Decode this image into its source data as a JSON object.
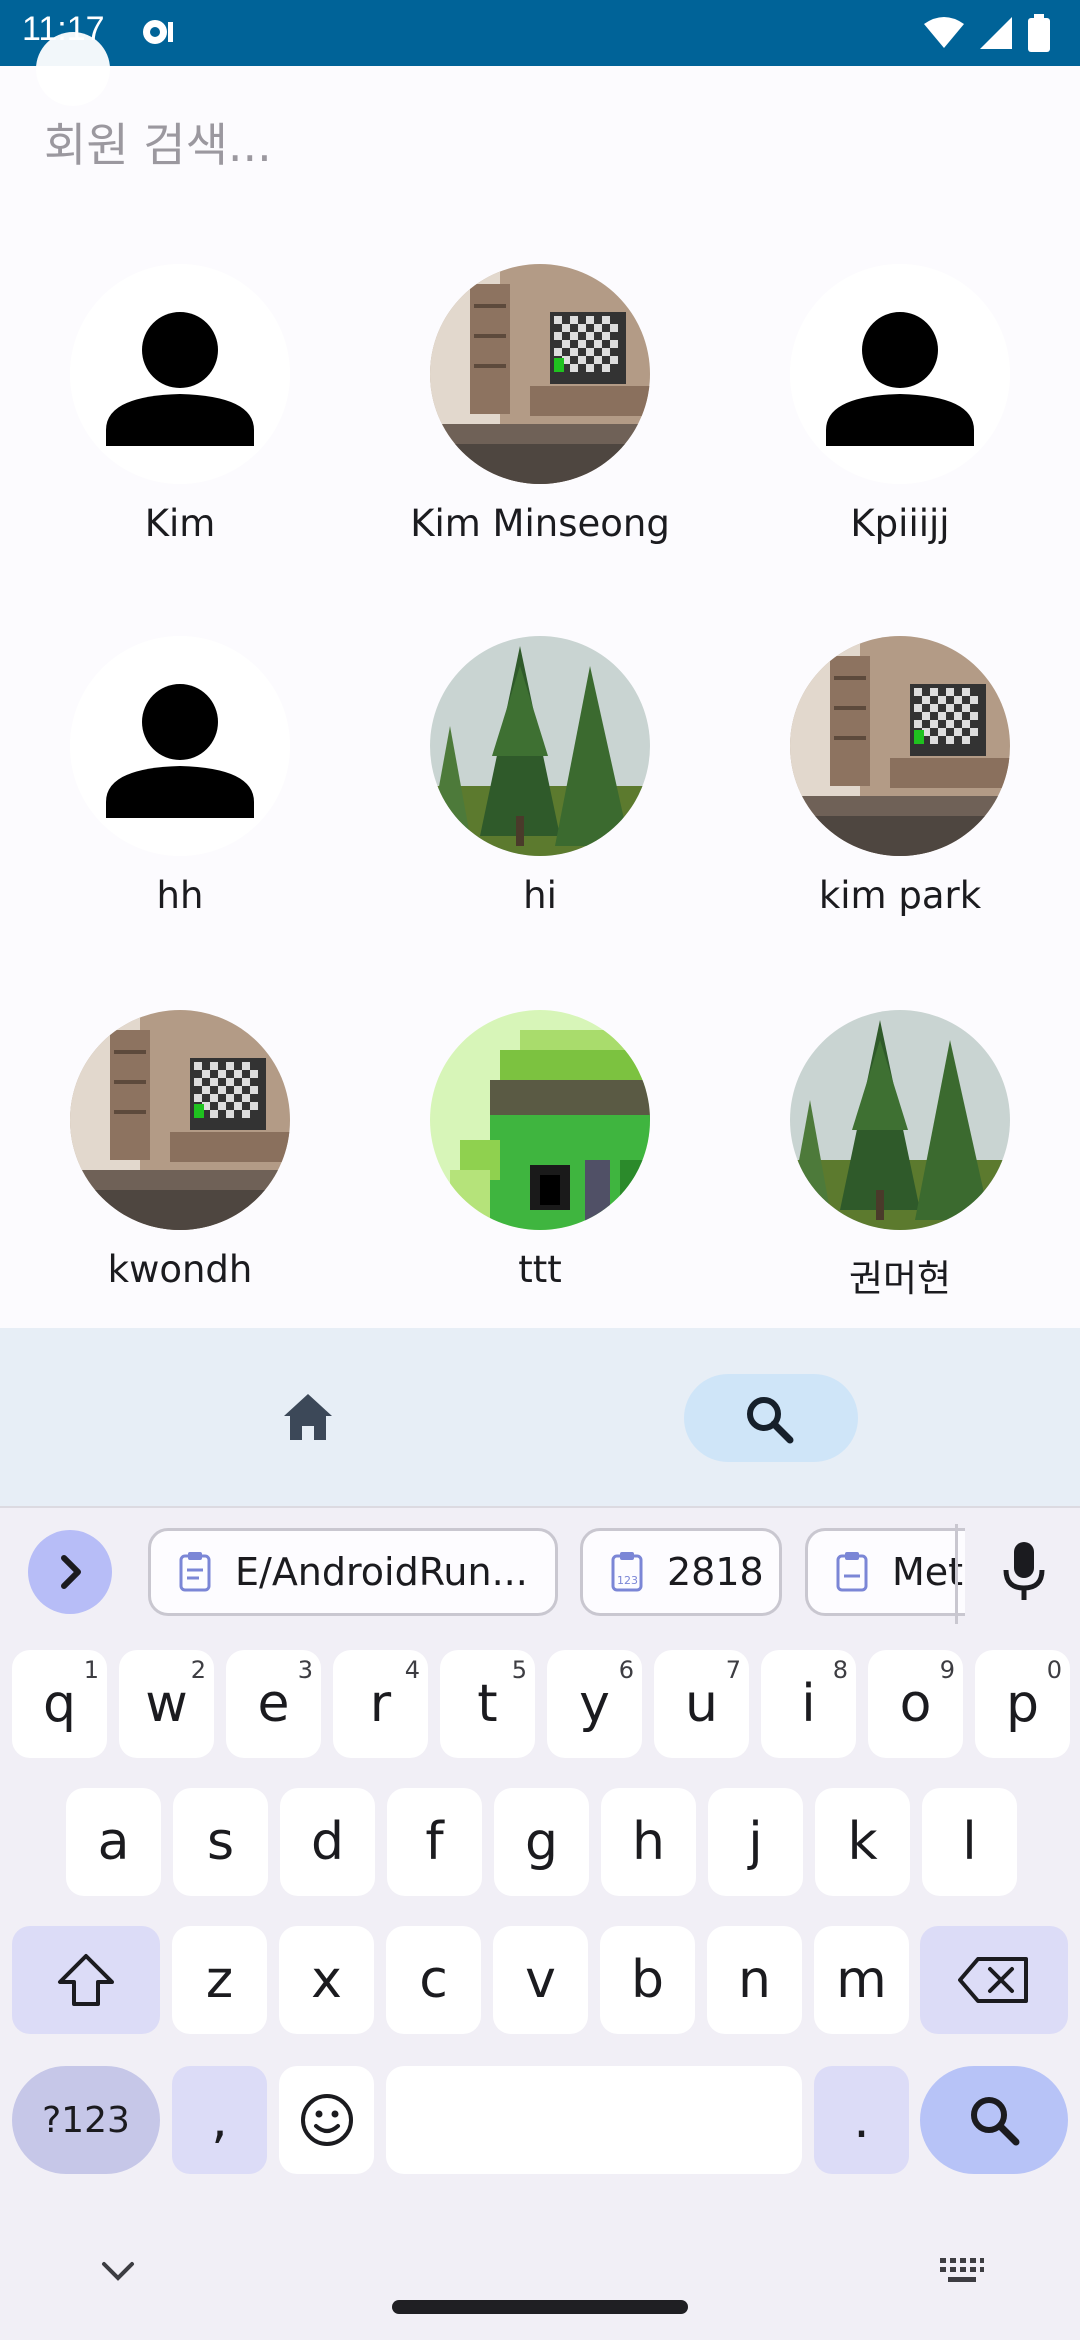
{
  "status": {
    "time": "11:17"
  },
  "search": {
    "placeholder": "회원 검색..."
  },
  "members": [
    {
      "name": "Kim",
      "avatar": "default-person"
    },
    {
      "name": "Kim Minseong",
      "avatar": "room-photo"
    },
    {
      "name": "Kpiiijj",
      "avatar": "default-person"
    },
    {
      "name": "hh",
      "avatar": "default-person"
    },
    {
      "name": "hi",
      "avatar": "trees-photo"
    },
    {
      "name": "kim park",
      "avatar": "room-photo"
    },
    {
      "name": "kwondh",
      "avatar": "room-photo"
    },
    {
      "name": "ttt",
      "avatar": "pixel-green"
    },
    {
      "name": "권머현",
      "avatar": "trees-photo"
    }
  ],
  "bottom_nav": {
    "items": [
      "home-icon",
      "search-icon"
    ],
    "selected": "search"
  },
  "keyboard": {
    "clipboard_chips": [
      "E/AndroidRun...",
      "2818",
      "Met"
    ],
    "row1": [
      {
        "key": "q",
        "hint": "1"
      },
      {
        "key": "w",
        "hint": "2"
      },
      {
        "key": "e",
        "hint": "3"
      },
      {
        "key": "r",
        "hint": "4"
      },
      {
        "key": "t",
        "hint": "5"
      },
      {
        "key": "y",
        "hint": "6"
      },
      {
        "key": "u",
        "hint": "7"
      },
      {
        "key": "i",
        "hint": "8"
      },
      {
        "key": "o",
        "hint": "9"
      },
      {
        "key": "p",
        "hint": "0"
      }
    ],
    "row2": [
      "a",
      "s",
      "d",
      "f",
      "g",
      "h",
      "j",
      "k",
      "l"
    ],
    "row3": [
      "z",
      "x",
      "c",
      "v",
      "b",
      "n",
      "m"
    ],
    "symbols_label": "?123",
    "comma": ",",
    "period": "."
  },
  "colors": {
    "status_bar": "#006398",
    "nav_bg": "#e7eef6",
    "nav_selected": "#cfe5f8",
    "keyboard_bg": "#f1eff6",
    "enter_key": "#b7c3f7"
  }
}
